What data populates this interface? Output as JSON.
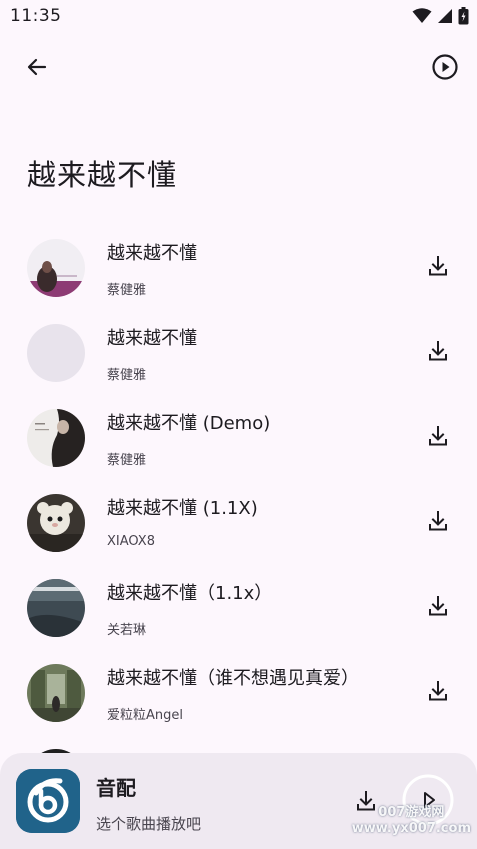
{
  "status_bar": {
    "time": "11:35",
    "icons": [
      "wifi-icon",
      "signal-icon",
      "battery-icon"
    ]
  },
  "top_bar": {
    "back_icon": "arrow-left-icon",
    "play_icon": "play-circle-icon"
  },
  "page": {
    "title": "越来越不懂"
  },
  "songs": [
    {
      "title": "越来越不懂",
      "artist": "蔡健雅"
    },
    {
      "title": "越来越不懂",
      "artist": "蔡健雅"
    },
    {
      "title": "越来越不懂 (Demo)",
      "artist": "蔡健雅"
    },
    {
      "title": "越来越不懂 (1.1X)",
      "artist": "XIAOX8"
    },
    {
      "title": "越来越不懂（1.1x）",
      "artist": "关若琳"
    },
    {
      "title": "越来越不懂（谁不想遇见真爱）",
      "artist": "爱粒粒Angel"
    }
  ],
  "player": {
    "title": "音配",
    "subtitle": "选个歌曲播放吧"
  },
  "watermark": "007游戏网\nwww.yx007.com",
  "colors": {
    "background": "#fdf7fd",
    "player_bg": "#efe9f1",
    "logo_bg": "#20638a",
    "text_primary": "#1d1b20",
    "text_secondary": "#49454f"
  }
}
